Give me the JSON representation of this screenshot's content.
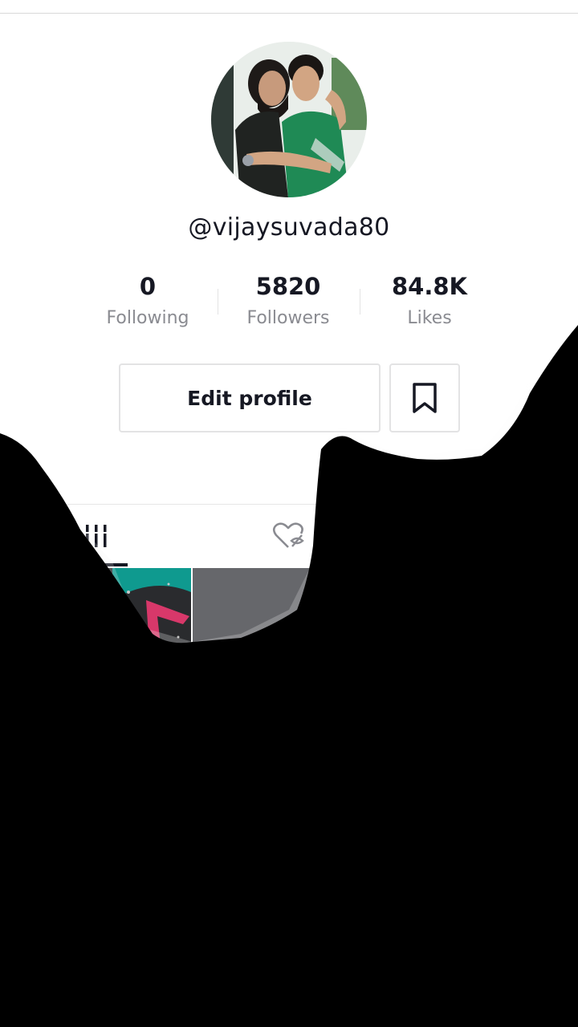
{
  "profile": {
    "username": "@vijaysuvada80",
    "avatar_alt": "",
    "stats": {
      "following": {
        "value": "0",
        "label": "Following"
      },
      "followers": {
        "value": "5820",
        "label": "Followers"
      },
      "likes": {
        "value": "84.8K",
        "label": "Likes"
      }
    },
    "edit_label": "Edit profile"
  },
  "icons": {
    "bookmark": "bookmark-icon",
    "videos_tab": "grid-icon",
    "liked_tab": "hidden-heart-icon"
  },
  "colors": {
    "text_primary": "#161823",
    "text_secondary": "#8a8b91",
    "border": "#e3e3e4",
    "background": "#ffffff",
    "overlay": "#000000"
  }
}
